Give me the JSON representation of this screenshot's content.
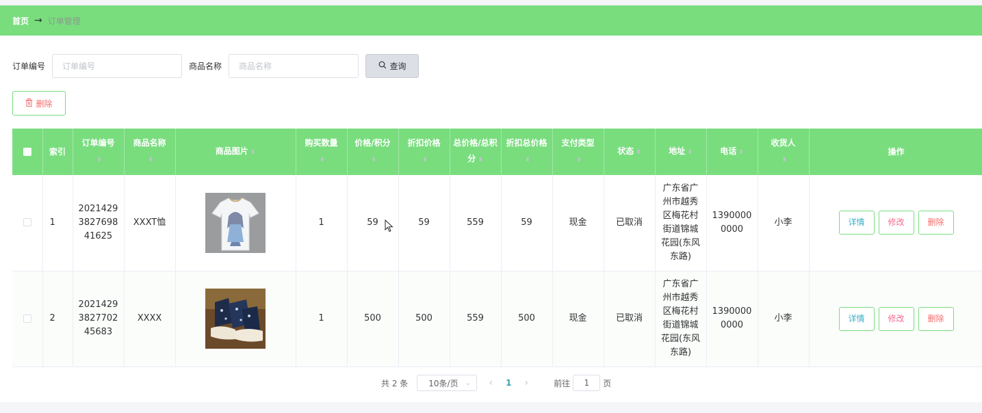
{
  "breadcrumb": {
    "home": "首页",
    "separator": "→",
    "current": "订单管理"
  },
  "search": {
    "order_no_label": "订单编号",
    "order_no_placeholder": "订单编号",
    "product_name_label": "商品名称",
    "product_name_placeholder": "商品名称",
    "query_label": "查询",
    "query_icon": "search-icon"
  },
  "toolbar": {
    "delete_label": "删除",
    "delete_icon": "trash-icon"
  },
  "table": {
    "headers": {
      "index": "索引",
      "order_no": "订单编号",
      "product_name": "商品名称",
      "product_image": "商品图片",
      "quantity": "购买数量",
      "price": "价格/积分",
      "discount_price": "折扣价格",
      "total": "总价格/总积分",
      "discount_total": "折扣总价格",
      "pay_type": "支付类型",
      "status": "状态",
      "address": "地址",
      "phone": "电话",
      "receiver": "收货人",
      "actions": "操作"
    },
    "rows": [
      {
        "index": "1",
        "order_no": "202142938276984162​5",
        "order_no_lines": [
          "2021429",
          "3827698",
          "41625"
        ],
        "product_name": "XXXT恤",
        "product_image": "tshirt-image",
        "quantity": "1",
        "price": "59",
        "discount_price": "59",
        "total": "559",
        "discount_total": "59",
        "pay_type": "现金",
        "status": "已取消",
        "address_lines": [
          "广东省广",
          "州市越秀",
          "区梅花村",
          "街道锦城",
          "花园(东风",
          "东路)"
        ],
        "phone_lines": [
          "1390000",
          "0000"
        ],
        "receiver": "小李"
      },
      {
        "index": "2",
        "order_no_lines": [
          "2021429",
          "3827702",
          "45683"
        ],
        "product_name": "XXXX",
        "product_image": "sneaker-image",
        "quantity": "1",
        "price": "500",
        "discount_price": "500",
        "total": "559",
        "discount_total": "500",
        "pay_type": "现金",
        "status": "已取消",
        "address_lines": [
          "广东省广",
          "州市越秀",
          "区梅花村",
          "街道锦城",
          "花园(东风",
          "东路)"
        ],
        "phone_lines": [
          "1390000",
          "0000"
        ],
        "receiver": "小李"
      }
    ],
    "action_labels": {
      "detail": "详情",
      "edit": "修改",
      "delete": "删除"
    }
  },
  "pagination": {
    "total_text": "共 2 条",
    "page_size": "10条/页",
    "current_page": "1",
    "goto_label": "前往",
    "goto_value": "1",
    "page_suffix": "页"
  },
  "colors": {
    "accent": "#79dd7e",
    "danger": "#f56c6c",
    "info": "#3bb0c9"
  }
}
